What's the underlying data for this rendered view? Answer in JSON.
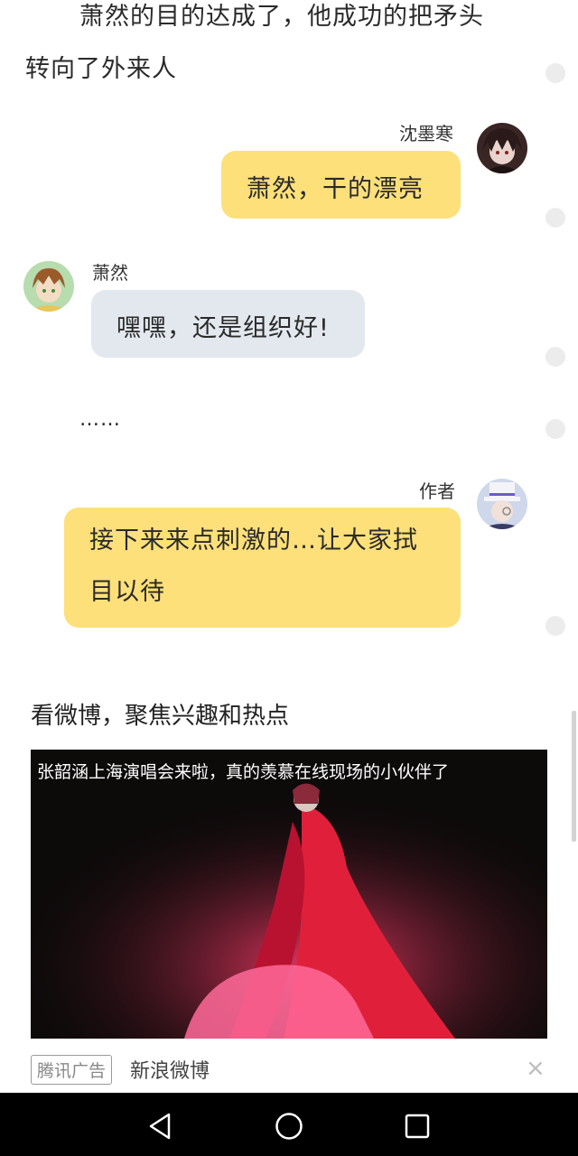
{
  "narration": {
    "line1": "萧然的目的达成了，他成功的把矛头",
    "line2": "转向了外来人",
    "ellipsis": "……"
  },
  "messages": [
    {
      "sender": "沈墨寒",
      "text": "萧然，干的漂亮",
      "side": "right"
    },
    {
      "sender": "萧然",
      "text": "嘿嘿，还是组织好!",
      "side": "left"
    },
    {
      "sender": "作者",
      "text_line1": "接下来来点刺激的…让大家拭",
      "text_line2": "目以待",
      "side": "right"
    }
  ],
  "ad": {
    "title": "看微博，聚焦兴趣和热点",
    "caption": "张韶涵上海演唱会来啦，真的羡慕在线现场的小伙伴了",
    "badge": "腾讯广告",
    "source": "新浪微博",
    "close_icon": "×"
  },
  "nav": {
    "back_icon": "back-triangle",
    "home_icon": "home-circle",
    "recents_icon": "recents-square"
  },
  "colors": {
    "yellow_bubble": "#fde07a",
    "gray_bubble": "#e3e8ef"
  }
}
